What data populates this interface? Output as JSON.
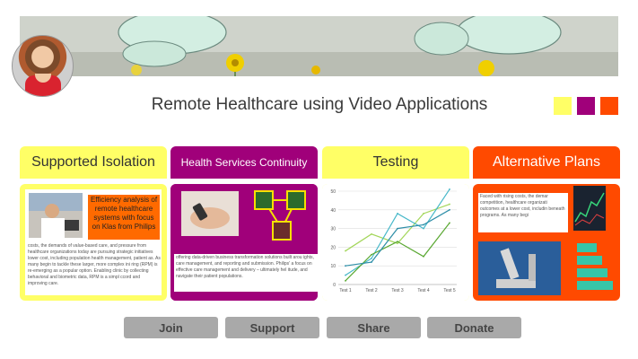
{
  "title": "Remote Healthcare using Video Applications",
  "swatches": [
    "#ffff66",
    "#a0007a",
    "#ff4a00"
  ],
  "panels": {
    "isolation": {
      "heading": "Supported Isolation",
      "callout": "Efficiency analysis of remote healthcare systems with focus on Klas from Philips",
      "text": "costs, the demands of value-based care, and pressure from healthcare organizations today are pursuing strategic initiatives lower cost, including population health management, patient as. As many begin to tackle these larger, more complex ini ring (RPM) is re-emerging as a popular option. Enabling clinic by collecting behavioral and biometric data, RPM is a simpl ccord and improving care."
    },
    "continuity": {
      "heading": "Health Services Continuity",
      "text": "offering data-driven business transformation solutions built arou ights, care management, and reporting and submission. Philips' a focus on effective care management and delivery – ultimately hel itude, and navigate their patient populations."
    },
    "testing": {
      "heading": "Testing"
    },
    "alternative": {
      "heading": "Alternative Plans",
      "text": "Faced with rising costs, the demar competition, healthcare organizati outcomes at a lower cost, includin beneath programs. As many begi"
    }
  },
  "chart_data": {
    "type": "line",
    "categories": [
      "Test 1",
      "Test 2",
      "Test 3",
      "Test 4",
      "Test 5"
    ],
    "series": [
      {
        "values": [
          18,
          27,
          22,
          38,
          43
        ]
      },
      {
        "values": [
          5,
          14,
          38,
          30,
          51
        ]
      },
      {
        "values": [
          2,
          16,
          23,
          15,
          33
        ]
      },
      {
        "values": [
          10,
          12,
          30,
          32,
          40
        ]
      }
    ],
    "y_ticks": [
      "0",
      "10",
      "20",
      "30",
      "40",
      "50"
    ],
    "ylim": [
      0,
      50
    ],
    "colors": [
      "#a3d65a",
      "#47b8c9",
      "#5aa832",
      "#2f8fa8"
    ],
    "grid": true
  },
  "buttons": {
    "join": "Join",
    "support": "Support",
    "share": "Share",
    "donate": "Donate"
  }
}
